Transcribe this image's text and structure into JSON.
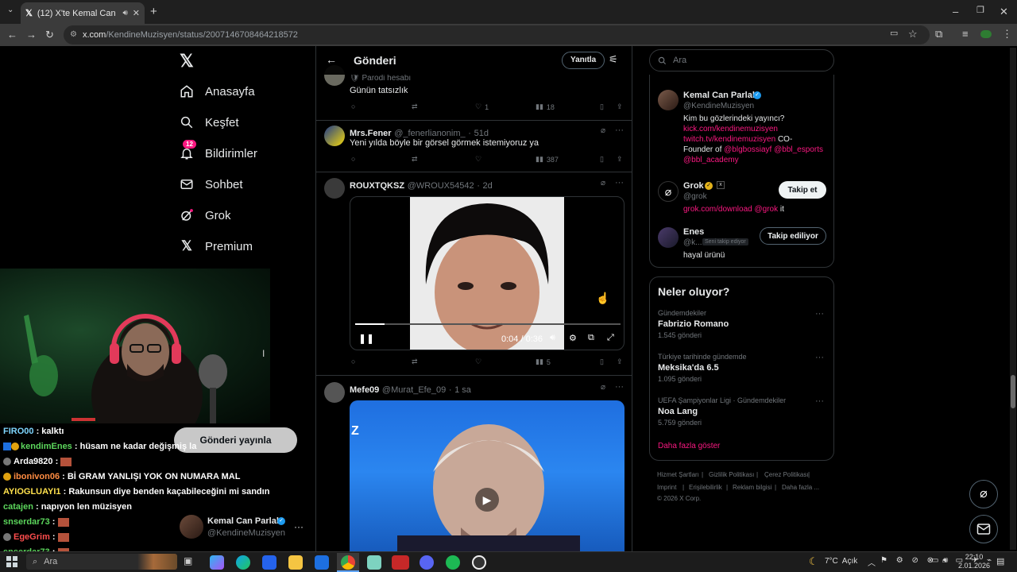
{
  "browser": {
    "tab_title": "(12) X'te Kemal Can Parlak",
    "url_domain": "x.com",
    "url_path": "/KendineMuzisyen/status/2007146708464218572"
  },
  "nav": {
    "items": [
      {
        "label": "Anasayfa",
        "icon": "home-icon"
      },
      {
        "label": "Keşfet",
        "icon": "search-icon"
      },
      {
        "label": "Bildirimler",
        "icon": "bell-icon",
        "badge": "12"
      },
      {
        "label": "Sohbet",
        "icon": "envelope-icon"
      },
      {
        "label": "Grok",
        "icon": "grok-icon"
      },
      {
        "label": "Premium",
        "icon": "x-logo-icon"
      }
    ],
    "publish_label": "Gönderi yayınla",
    "account_name": "Kemal Can Parlak",
    "account_handle": "@KendineMuzisyen"
  },
  "header": {
    "title": "Gönderi",
    "reply_label": "Yanıtla"
  },
  "posts": [
    {
      "label_line": "Parodi hesabı",
      "text": "Günün tatsızlık",
      "likes": "1",
      "views": "18"
    },
    {
      "name": "Mrs.Fener",
      "handle": "@_fenerlianonim_",
      "time": "51d",
      "text": "Yeni yılda böyle bir görsel görmek istemiyoruz ya",
      "views": "387"
    },
    {
      "name": "ROUXTQKSZ",
      "handle": "@WROUX54542",
      "time": "2d",
      "video_time": "0:04 / 0:36",
      "video_progress": 0.11,
      "views": "5"
    },
    {
      "name": "Mefe09",
      "handle": "@Murat_Efe_09",
      "time": "1 sa"
    }
  ],
  "right": {
    "search_placeholder": "Ara",
    "people": [
      {
        "name": "Kemal Can Parlak",
        "handle": "@KendineMuzisyen",
        "bio_line1": "Kim bu gözlerindeki yayıncı?",
        "bio_link1": "kick.com/kendinemuzisyen",
        "bio_link2": "twitch.tv/kendinemuzisyen",
        "bio_tail": "CO-",
        "bio_line4_a": "Founder of",
        "bio_mention1": "@blgbossiayf",
        "bio_mention2": "@bbl_esports",
        "bio_mention3": "@bbl_academy"
      },
      {
        "name": "Grok",
        "handle": "@grok",
        "bio_link": "grok.com/download",
        "bio_mention": "@grok",
        "bio_tail": "it",
        "button": "Takip et"
      },
      {
        "name": "Enes",
        "handle": "@k...",
        "follows_you": "Seni takip ediyor",
        "bio": "hayal ürünü",
        "button": "Takip ediliyor"
      }
    ],
    "trends_title": "Neler oluyor?",
    "trends": [
      {
        "category": "Gündemdekiler",
        "name": "Fabrizio Romano",
        "count": "1.545 gönderi"
      },
      {
        "category": "Türkiye tarihinde gündemde",
        "name": "Meksika'da 6.5",
        "count": "1.095 gönderi"
      },
      {
        "category": "UEFA Şampiyonlar Ligi · Gündemdekiler",
        "name": "Noa Lang",
        "count": "5.759 gönderi"
      }
    ],
    "show_more": "Daha fazla göster",
    "footer": [
      "Hizmet Şartları",
      "Gizlilik Politikası",
      "Çerez Politikası",
      "Imprint",
      "Erişilebilirlik",
      "Reklam bilgisi",
      "Daha fazla ...",
      "© 2026 X Corp."
    ]
  },
  "chat": [
    {
      "user": "FIRO00",
      "msg": ": kalktı",
      "color": "#7fd6ff"
    },
    {
      "user": "kendimEnes",
      "msg": ": hüsam ne kadar değişmiş la",
      "color": "#5cd65c"
    },
    {
      "user": "Arda9820",
      "msg": ":",
      "color": "#ffffff"
    },
    {
      "user": "ibonivon06",
      "msg": ": Bİ GRAM YANLIŞI YOK ON NUMARA MAL",
      "color": "#ff8c42"
    },
    {
      "user": "AYIOGLUAYI1",
      "msg": ": Rakunsun diye benden kaçabileceğini mi sandın",
      "color": "#ffe14d"
    },
    {
      "user": "catajen",
      "msg": ": napıyon len müzisyen",
      "color": "#5cd65c"
    },
    {
      "user": "snserdar73",
      "msg": ":",
      "color": "#5cd65c"
    },
    {
      "user": "EgeGrim",
      "msg": ":",
      "color": "#ff4d4d"
    },
    {
      "user": "snserdar73",
      "msg": ":",
      "color": "#5cd65c"
    }
  ],
  "taskbar": {
    "search": "Ara",
    "weather": "7°C  Açık",
    "time": "22:10",
    "date": "2.01.2026"
  }
}
